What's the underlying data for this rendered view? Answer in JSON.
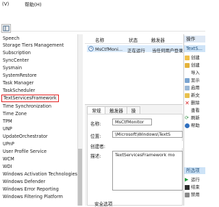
{
  "menubar": {
    "items": [
      "(V)",
      "帮助(H)"
    ]
  },
  "tree": {
    "items": [
      "Speech",
      "Storage Tiers Management",
      "Subscription",
      "SyncCenter",
      "Sysmain",
      "SystemRestore",
      "Task Manager",
      "TaskScheduler",
      "TextServicesFramework",
      "Time Synchronization",
      "Time Zone",
      "TPM",
      "UNP",
      "UpdateOrchestrator",
      "UPnP",
      "User Profile Service",
      "WCM",
      "WDI",
      "Windows Activation Technologies",
      "Windows Defender",
      "Windows Error Reporting",
      "Windows Filtering Platform"
    ],
    "selected_index": 8
  },
  "list": {
    "columns": [
      "名称",
      "状态",
      "触发器"
    ],
    "row": {
      "name": "MsCtfMoni...",
      "status": "正在运行",
      "trigger": "当任何用户登录时"
    }
  },
  "details": {
    "tabs": [
      "常规",
      "触发器",
      "操"
    ],
    "name_label": "名称:",
    "name_value": "MsCtfMonitor",
    "location_label": "位置:",
    "location_value": "\\Microsoft\\Windows\\TextS",
    "author_label": "创建者:",
    "author_value": "",
    "description_label": "描述:",
    "description_value": "TextServicesFramework mo",
    "security_label": "安全选项"
  },
  "actions": {
    "header": "操作",
    "section1": "TextS...",
    "items1": [
      "创建",
      "创建",
      "导入",
      "显示",
      "启用",
      "新文",
      "删除",
      "查看",
      "刷新",
      "帮助"
    ],
    "section2": "所选项",
    "items2": [
      "运行",
      "结束",
      "禁用"
    ]
  }
}
